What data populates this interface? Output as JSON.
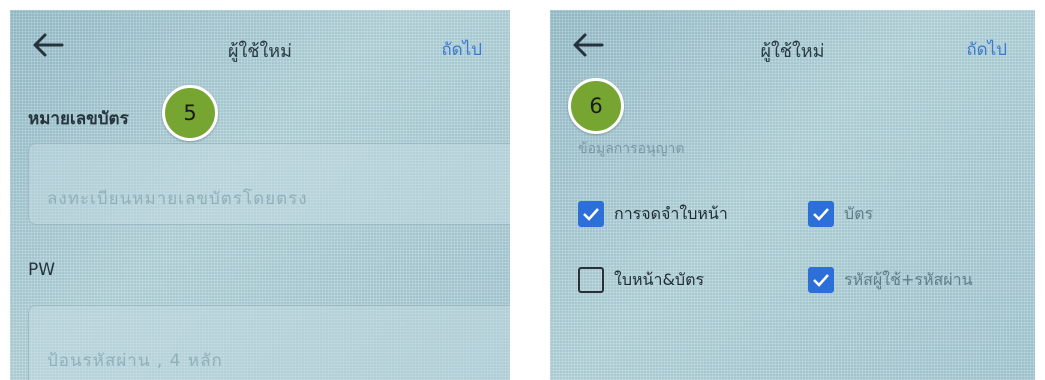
{
  "screens": [
    {
      "title": "ผู้ใช้ใหม่",
      "next_label": "ถัดไป",
      "step": "5",
      "card_label": "หมายเลขบัตร",
      "card_placeholder": "ลงทะเบียนหมายเลขบัตรโดยตรง",
      "pw_label": "PW",
      "pw_placeholder": "ป้อนรหัสผ่าน , 4 หลัก"
    },
    {
      "title": "ผู้ใช้ใหม่",
      "next_label": "ถัดไป",
      "step": "6",
      "section_label": "ข้อมูลการอนุญาต",
      "options": [
        {
          "label": "การจดจำใบหน้า",
          "checked": true
        },
        {
          "label": "บัตร",
          "checked": true
        },
        {
          "label": "ใบหน้า&บัตร",
          "checked": false
        },
        {
          "label": "รหัสผู้ใช้+รหัสผ่าน",
          "checked": true
        }
      ]
    }
  ],
  "colors": {
    "accent": "#3d7bd0",
    "badge": "#76a532",
    "checkbox": "#2d6fd8"
  },
  "icons": {
    "back": "arrow-left-icon",
    "check": "checkmark-icon"
  }
}
